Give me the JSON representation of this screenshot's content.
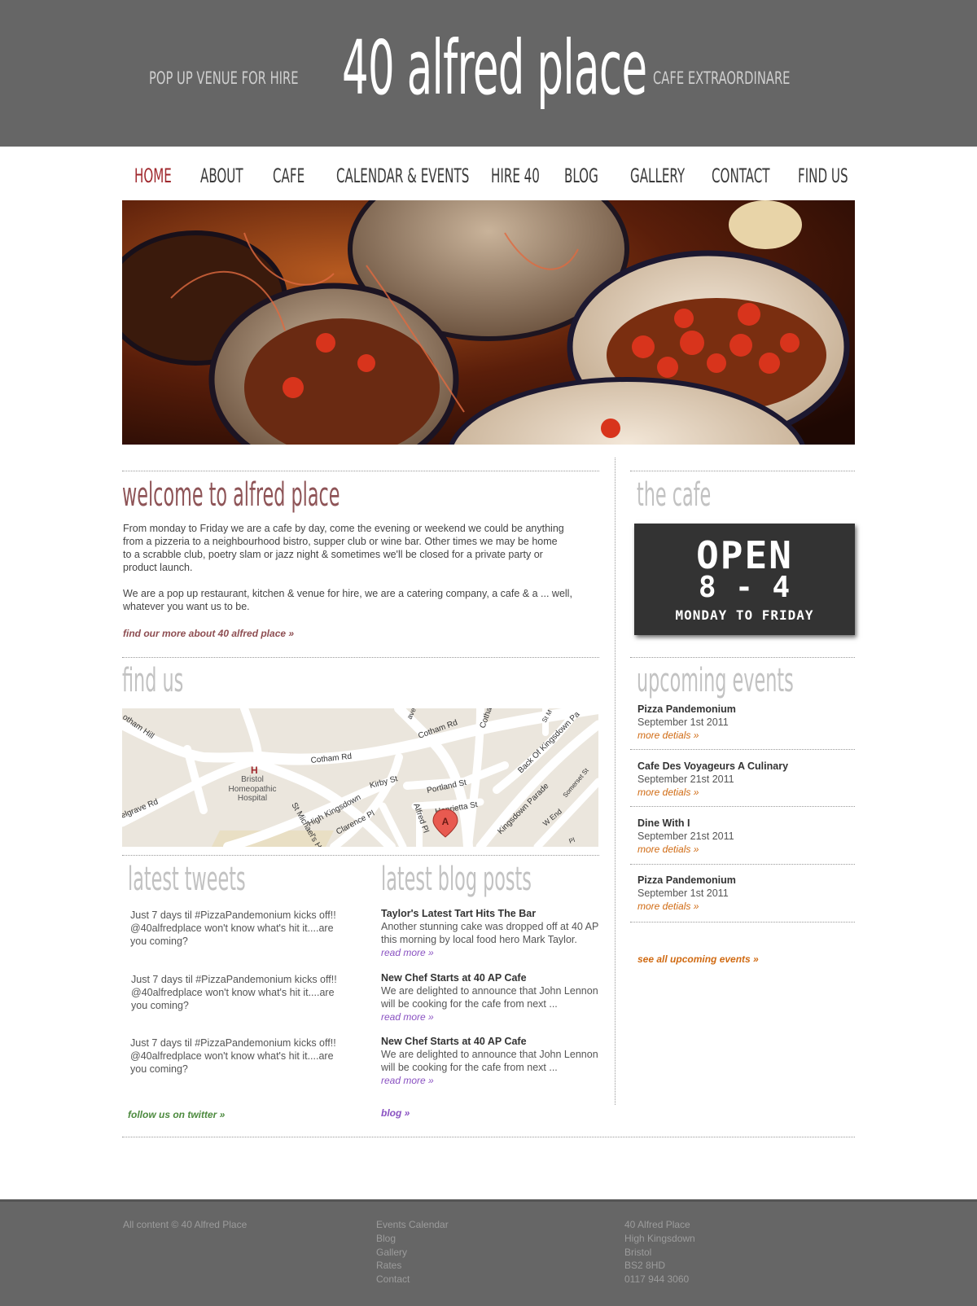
{
  "header": {
    "tagline_left": "POP UP VENUE FOR HIRE",
    "logo": "40 alfred place",
    "tagline_right": "CAFE EXTRAORDINARE"
  },
  "nav": {
    "items": [
      {
        "label": "HOME",
        "active": true
      },
      {
        "label": "ABOUT"
      },
      {
        "label": "CAFE"
      },
      {
        "label": "CALENDAR & EVENTS"
      },
      {
        "label": "HIRE 40"
      },
      {
        "label": "BLOG"
      },
      {
        "label": "GALLERY"
      },
      {
        "label": "CONTACT"
      },
      {
        "label": "FIND US"
      }
    ]
  },
  "welcome": {
    "title": "welcome to alfred place",
    "para1": "From monday to Friday we are a cafe by day, come the evening or weekend we could be anything from a pizzeria to a neighbourhood bistro, supper club or wine bar. Other times we may be home to a scrabble club, poetry slam or jazz night & sometimes we'll be closed for a private party or product launch.",
    "para2": "We are a pop up restaurant, kitchen & venue for hire, we are a catering company, a cafe & a ...  well, whatever you want us to be.",
    "link": "find our more about 40 alfred place »"
  },
  "find_us": {
    "title": "find us",
    "map_labels": {
      "hospital_h": "H",
      "hospital": "Bristol Homeopathic Hospital",
      "cotham_rd": "Cotham Rd",
      "cotham_rd2": "Cotham Rd",
      "cotham_hill": "otham Hill",
      "belgrave": "elgrave Rd",
      "high_kingsdown": "High Kingsdown",
      "kirby": "Kirby St",
      "clarence": "Clarence Pl",
      "portland": "Portland St",
      "henrietta": "Henrietta St",
      "alfred_pl": "Alfred Pl",
      "st_michaels": "St Michael's H",
      "kingsdown_parade": "Kingsdown Parade",
      "back_kingsdown": "Back Of Kingsdown Pa",
      "w_end": "W End",
      "somerset": "Somerset St",
      "cotha": "Cotha",
      "st_m": "St M",
      "ave": "ave",
      "pl": "Pl",
      "marker": "A"
    }
  },
  "cafe": {
    "title": "the cafe",
    "sign_line1": "OPEN",
    "sign_line2": "8 - 4",
    "sign_line3": "MONDAY TO FRIDAY"
  },
  "events": {
    "title": "upcoming events",
    "items": [
      {
        "title": "Pizza Pandemonium",
        "date": "September 1st 2011",
        "more": "more detials »"
      },
      {
        "title": "Cafe Des Voyageurs A Culinary",
        "date": "September 21st 2011",
        "more": "more detials »"
      },
      {
        "title": "Dine With I",
        "date": "September 21st 2011",
        "more": "more detials »"
      },
      {
        "title": "Pizza Pandemonium",
        "date": "September 1st 2011",
        "more": "more detials »"
      }
    ],
    "see_all": "see all upcoming events »"
  },
  "tweets": {
    "title": "latest tweets",
    "items": [
      "Just 7 days til #PizzaPandemonium kicks off!! @40alfredplace won't know what's hit it....are you coming?",
      "Just 7 days til #PizzaPandemonium kicks off!! @40alfredplace won't know what's hit it....are you coming?",
      "Just 7 days til #PizzaPandemonium kicks off!! @40alfredplace won't know what's hit it....are you coming?"
    ],
    "follow": "follow us on twitter  »"
  },
  "blog": {
    "title": "latest blog posts",
    "items": [
      {
        "title": "Taylor's Latest Tart Hits The Bar",
        "text": "Another stunning cake was dropped off at 40 AP this morning by local food hero Mark Taylor.",
        "more": "read more »"
      },
      {
        "title": "New Chef Starts at 40 AP Cafe",
        "text": "We are delighted to announce that John Lennon will be cooking for the cafe from next ...",
        "more": "read more »"
      },
      {
        "title": "New Chef Starts at 40 AP Cafe",
        "text": "We are delighted to announce that John Lennon will be cooking for the cafe from next ...",
        "more": "read more »"
      }
    ],
    "link": "blog  »"
  },
  "footer": {
    "copyright": "All content © 40 Alfred Place",
    "links": [
      "Events Calendar",
      "Blog",
      "Gallery",
      "Rates",
      "Contact"
    ],
    "address": [
      "40 Alfred Place",
      "High Kingsdown",
      "Bristol",
      "BS2 8HD",
      "0117 944 3060"
    ]
  },
  "colors": {
    "header_bg": "#666666",
    "nav_active": "#a0292e",
    "welcome_title": "#8e5457",
    "events_link": "#d06a12",
    "twitter_link": "#4c8a3e",
    "blog_link": "#8a52c2"
  }
}
